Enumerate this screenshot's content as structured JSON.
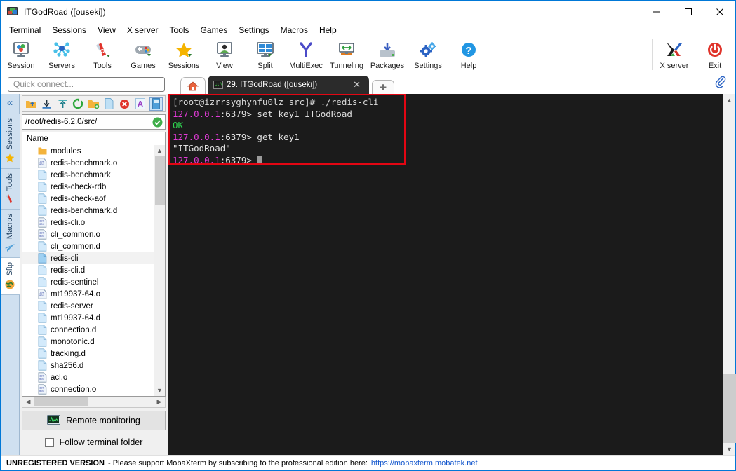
{
  "window": {
    "title": "ITGodRoad ([ouseki])",
    "icon": "mobaxterm-logo-icon",
    "controls": {
      "minimize": "—",
      "maximize": "□",
      "close": "✕"
    }
  },
  "menubar": {
    "items": [
      "Terminal",
      "Sessions",
      "View",
      "X server",
      "Tools",
      "Games",
      "Settings",
      "Macros",
      "Help"
    ]
  },
  "toolbar": {
    "left_buttons": [
      {
        "label": "Session",
        "icon": "session-icon"
      },
      {
        "label": "Servers",
        "icon": "servers-icon"
      },
      {
        "label": "Tools",
        "icon": "tools-icon"
      },
      {
        "label": "Games",
        "icon": "games-icon"
      },
      {
        "label": "Sessions",
        "icon": "sessions-star-icon"
      },
      {
        "label": "View",
        "icon": "view-icon"
      },
      {
        "label": "Split",
        "icon": "split-icon"
      },
      {
        "label": "MultiExec",
        "icon": "multiexec-icon"
      },
      {
        "label": "Tunneling",
        "icon": "tunneling-icon"
      },
      {
        "label": "Packages",
        "icon": "packages-icon"
      },
      {
        "label": "Settings",
        "icon": "settings-gear-icon"
      },
      {
        "label": "Help",
        "icon": "help-icon"
      }
    ],
    "right_buttons": [
      {
        "label": "X server",
        "icon": "xserver-icon"
      },
      {
        "label": "Exit",
        "icon": "exit-power-icon"
      }
    ]
  },
  "quick_connect": {
    "placeholder": "Quick connect..."
  },
  "tabs": {
    "home_icon": "home-icon",
    "terminal_tab": {
      "label": "29. ITGodRoad ([ouseki])",
      "badge": "c:\\",
      "close": "✕"
    },
    "new_tab": "✚",
    "attach_icon": "paperclip-icon"
  },
  "vertical_tabs": {
    "collapse": "«",
    "items": [
      {
        "label": "Sessions",
        "icon": "star-icon",
        "active": false
      },
      {
        "label": "Tools",
        "icon": "swiss-knife-icon",
        "active": false
      },
      {
        "label": "Macros",
        "icon": "paper-plane-icon",
        "active": false
      },
      {
        "label": "Sftp",
        "icon": "globe-icon",
        "active": true
      }
    ]
  },
  "sftp": {
    "toolbar_icons": [
      "parent-folder-icon",
      "download-icon",
      "upload-icon",
      "refresh-icon",
      "new-folder-icon",
      "new-file-icon",
      "delete-icon",
      "text-edit-icon",
      "bookmark-icon"
    ],
    "path": "/root/redis-6.2.0/src/",
    "path_status_icon": "check-ok-icon",
    "column_header": "Name",
    "entries": [
      {
        "name": "modules",
        "type": "folder"
      },
      {
        "name": "redis-benchmark.o",
        "type": "binary"
      },
      {
        "name": "redis-benchmark",
        "type": "file"
      },
      {
        "name": "redis-check-rdb",
        "type": "file"
      },
      {
        "name": "redis-check-aof",
        "type": "file"
      },
      {
        "name": "redis-benchmark.d",
        "type": "file"
      },
      {
        "name": "redis-cli.o",
        "type": "binary"
      },
      {
        "name": "cli_common.o",
        "type": "binary"
      },
      {
        "name": "cli_common.d",
        "type": "file"
      },
      {
        "name": "redis-cli",
        "type": "file",
        "selected": true
      },
      {
        "name": "redis-cli.d",
        "type": "file"
      },
      {
        "name": "redis-sentinel",
        "type": "file"
      },
      {
        "name": "mt19937-64.o",
        "type": "binary"
      },
      {
        "name": "redis-server",
        "type": "file"
      },
      {
        "name": "mt19937-64.d",
        "type": "file"
      },
      {
        "name": "connection.d",
        "type": "file"
      },
      {
        "name": "monotonic.d",
        "type": "file"
      },
      {
        "name": "tracking.d",
        "type": "file"
      },
      {
        "name": "sha256.d",
        "type": "file"
      },
      {
        "name": "acl.o",
        "type": "binary"
      },
      {
        "name": "connection.o",
        "type": "binary"
      }
    ],
    "remote_monitoring": {
      "label": "Remote monitoring",
      "icon": "monitor-graph-icon"
    },
    "follow_terminal_folder": {
      "label": "Follow terminal folder",
      "checked": false
    }
  },
  "terminal": {
    "background": "#1b1b1b",
    "highlight_box_color": "#e30613",
    "lines": [
      {
        "segments": [
          {
            "text": "[root@izrrsyghynfu0lz src]# ./redis-cli",
            "color": "host"
          }
        ]
      },
      {
        "segments": [
          {
            "text": "127.0.0.1",
            "color": "ip"
          },
          {
            "text": ":6379> set key1 ITGodRoad",
            "color": "port"
          }
        ]
      },
      {
        "segments": [
          {
            "text": "OK",
            "color": "ok"
          }
        ]
      },
      {
        "segments": [
          {
            "text": "127.0.0.1",
            "color": "ip"
          },
          {
            "text": ":6379> get key1",
            "color": "port"
          }
        ]
      },
      {
        "segments": [
          {
            "text": "\"ITGodRoad\"",
            "color": "val"
          }
        ]
      },
      {
        "segments": [
          {
            "text": "127.0.0.1",
            "color": "ip"
          },
          {
            "text": ":6379> ",
            "color": "port"
          },
          {
            "text": "",
            "color": "cursor"
          }
        ]
      }
    ]
  },
  "statusbar": {
    "strong": "UNREGISTERED VERSION",
    "text": "-  Please support MobaXterm by subscribing to the professional edition here:",
    "link": "https://mobaxterm.mobatek.net"
  }
}
